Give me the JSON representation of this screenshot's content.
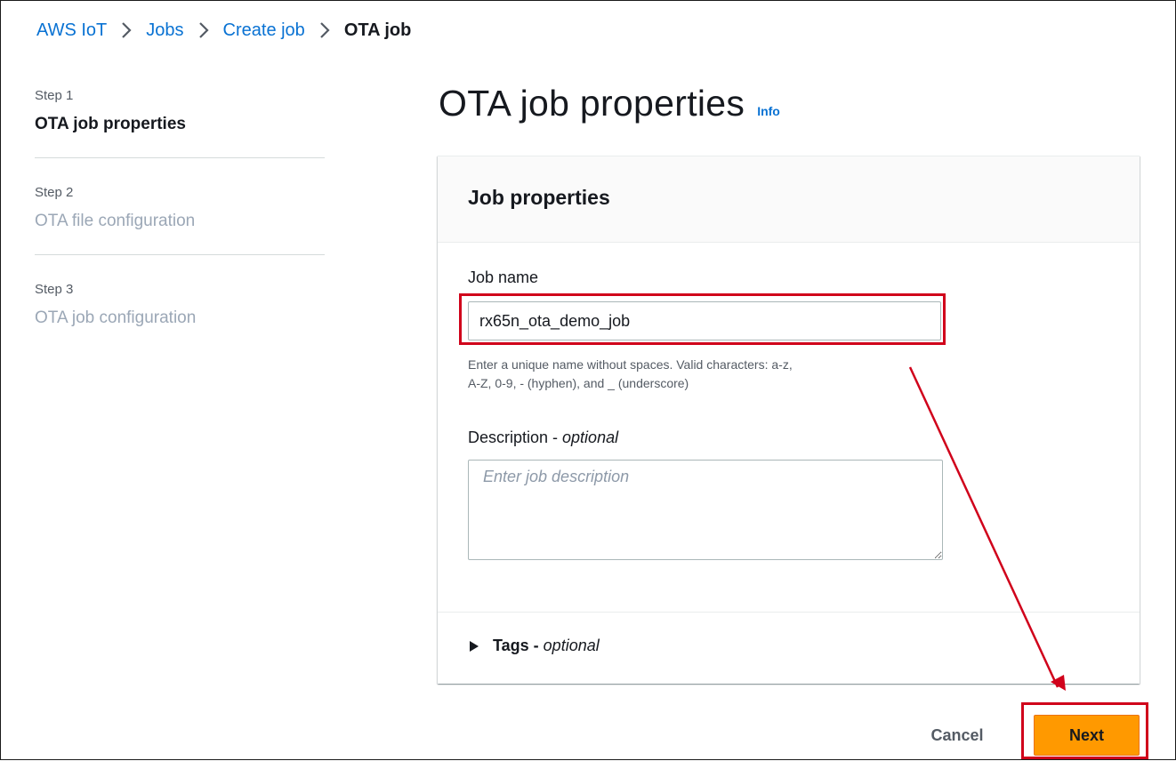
{
  "breadcrumb": {
    "items": [
      {
        "label": "AWS IoT"
      },
      {
        "label": "Jobs"
      },
      {
        "label": "Create job"
      },
      {
        "label": "OTA job"
      }
    ]
  },
  "steps": [
    {
      "number": "Step 1",
      "title": "OTA job properties",
      "state": "active"
    },
    {
      "number": "Step 2",
      "title": "OTA file configuration",
      "state": "inactive"
    },
    {
      "number": "Step 3",
      "title": "OTA job configuration",
      "state": "inactive"
    }
  ],
  "page": {
    "title": "OTA job properties",
    "info_label": "Info"
  },
  "card": {
    "header": "Job properties",
    "job_name": {
      "label": "Job name",
      "value": "rx65n_ota_demo_job",
      "hint_line1": "Enter a unique name without spaces. Valid characters: a-z,",
      "hint_line2": "A-Z, 0-9, - (hyphen), and _ (underscore)"
    },
    "description": {
      "label": "Description - ",
      "label_suffix": "optional",
      "placeholder": "Enter job description"
    },
    "tags": {
      "label": "Tags - ",
      "label_suffix": "optional"
    }
  },
  "footer": {
    "cancel_label": "Cancel",
    "next_label": "Next"
  },
  "colors": {
    "link": "#0972d3",
    "primary_button": "#ff9900",
    "annotation": "#d0021b",
    "inactive_step": "#9ba7b6"
  }
}
